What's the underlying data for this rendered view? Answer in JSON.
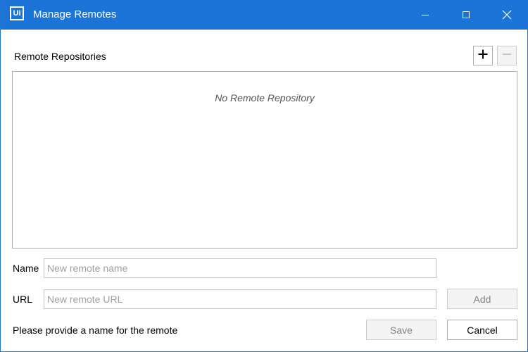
{
  "window": {
    "title": "Manage Remotes",
    "logo_text": "Ui",
    "accent_color": "#1b74d6"
  },
  "titlebar_buttons": {
    "minimize_icon": "minimize-icon",
    "maximize_icon": "maximize-icon",
    "close_icon": "close-icon"
  },
  "repositories": {
    "label": "Remote Repositories",
    "empty_text": "No Remote Repository",
    "add_icon": "plus-icon",
    "remove_icon": "minus-icon",
    "items": []
  },
  "form": {
    "name_label": "Name",
    "name_value": "",
    "name_placeholder": "New remote name",
    "url_label": "URL",
    "url_value": "",
    "url_placeholder": "New remote URL",
    "add_label": "Add"
  },
  "footer": {
    "status_text": "Please provide a name for the remote",
    "save_label": "Save",
    "cancel_label": "Cancel"
  }
}
